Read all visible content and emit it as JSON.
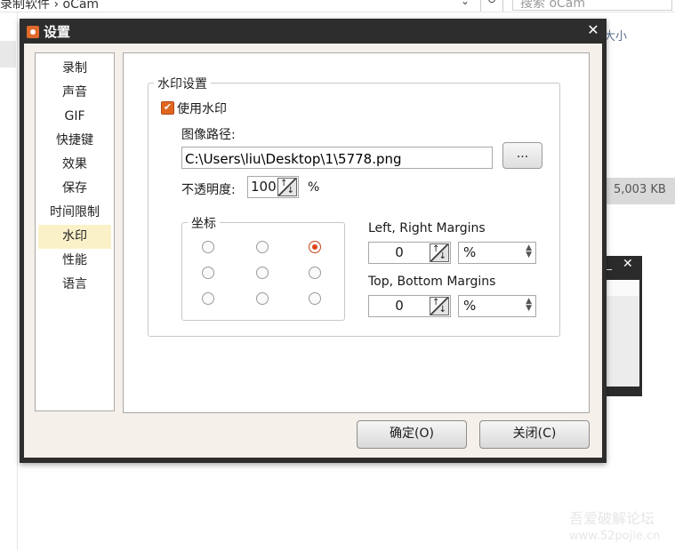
{
  "background": {
    "path_text": "录制软件 › oCam",
    "search_placeholder": "搜索 oCam",
    "column_header": "大小",
    "row_size": "5,003 KB",
    "watermark_line1": "吾爱破解论坛",
    "watermark_line2": "www.52pojie.cn"
  },
  "dialog": {
    "title": "设置",
    "nav": [
      {
        "label": "录制"
      },
      {
        "label": "声音"
      },
      {
        "label": "GIF"
      },
      {
        "label": "快捷键"
      },
      {
        "label": "效果"
      },
      {
        "label": "保存"
      },
      {
        "label": "时间限制"
      },
      {
        "label": "水印"
      },
      {
        "label": "性能"
      },
      {
        "label": "语言"
      }
    ],
    "active_nav": "水印",
    "watermark": {
      "group_title": "水印设置",
      "use_watermark_label": "使用水印",
      "use_watermark_checked": true,
      "image_path_label": "图像路径:",
      "image_path_value": "C:\\Users\\liu\\Desktop\\1\\5778.png",
      "browse_label": "...",
      "opacity_label": "不透明度:",
      "opacity_value": "100",
      "opacity_unit": "%",
      "coord_title": "坐标",
      "selected_position": "top-right",
      "lr_margin_label": "Left, Right Margins",
      "lr_margin_value": "0",
      "lr_margin_unit": "%",
      "tb_margin_label": "Top, Bottom Margins",
      "tb_margin_value": "0",
      "tb_margin_unit": "%"
    },
    "buttons": {
      "ok": "确定(O)",
      "close": "关闭(C)"
    }
  }
}
